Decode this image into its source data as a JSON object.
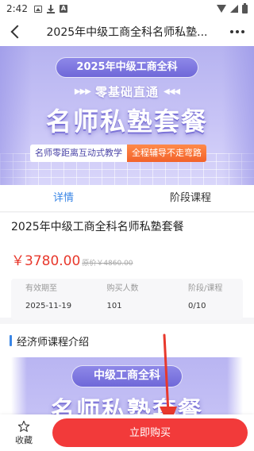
{
  "status_bar": {
    "time": "2:42"
  },
  "nav": {
    "title": "2025年中级工商全科名师私塾..."
  },
  "hero": {
    "pill": "2025年中级工商全科",
    "subtitle": "零基础直通",
    "arrows_left": "▶▶▶",
    "arrows_right": "◀◀◀",
    "main": "名师私塾套餐",
    "tag_a": "名师零距离互动式教学",
    "tag_b": "全程辅导不走弯路"
  },
  "tabs": [
    {
      "label": "详情",
      "active": true
    },
    {
      "label": "阶段课程",
      "active": false
    }
  ],
  "product": {
    "title": "2025年中级工商全科名师私塾套餐",
    "price": "￥3780.00",
    "original_price": "原价￥4860.00",
    "stats": [
      {
        "label": "有效期至",
        "value": "2025-11-19"
      },
      {
        "label": "购买人数",
        "value": "101"
      },
      {
        "label": "阶段/课程",
        "value": "0/10"
      }
    ]
  },
  "intro": {
    "title": "经济师课程介绍",
    "image_pill": "中级工商全科",
    "image_main": "名师私塾套餐"
  },
  "bottom_bar": {
    "favorite_label": "收藏",
    "buy_label": "立即购买"
  },
  "colors": {
    "accent_blue": "#3a86e6",
    "price_red": "#e8382c",
    "buy_button": "#f23a3a",
    "banner_purple": "#b6b3f0"
  },
  "icons": [
    "image-notification-icon",
    "download-icon",
    "app-notification-icon",
    "wifi-icon",
    "signal-icon",
    "battery-icon",
    "back-arrow-icon",
    "more-icon",
    "star-icon"
  ]
}
